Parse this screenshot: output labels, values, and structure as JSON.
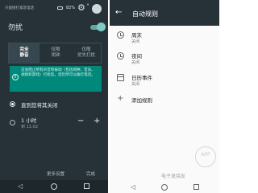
{
  "left": {
    "status": {
      "notification": "只能接打紧急电话",
      "battery": "82%"
    },
    "dnd": {
      "title": "勿扰",
      "toggle_on": true,
      "accent": "#80cbc4"
    },
    "modes": [
      {
        "line1": "完全",
        "line2": "静音",
        "selected": true
      },
      {
        "line1": "仅限",
        "line2": "闹钟",
        "selected": false
      },
      {
        "line1": "仅限",
        "line2": "优先打扰",
        "selected": false
      }
    ],
    "notice": {
      "text": "这会阻止所有声音和振动（包括闹钟、音乐、视频和游戏）打扰您。您仍然可以拨打电话。",
      "color": "#00897b"
    },
    "options": {
      "until_off": "直到您将其关闭",
      "duration_label": "1 小时",
      "duration_sub": "到 11:02"
    },
    "footer": {
      "more": "更多设置",
      "done": "完成"
    }
  },
  "right": {
    "title": "自动规则",
    "rules": [
      {
        "name": "周末",
        "state": "关闭",
        "icon": "clock-icon"
      },
      {
        "name": "夜间",
        "state": "关闭",
        "icon": "clock-icon"
      },
      {
        "name": "日历事件",
        "state": "关闭",
        "icon": "calendar-icon"
      }
    ],
    "add_rule": "添加规则",
    "watermark": "APP",
    "brand": "电子发烧友"
  }
}
